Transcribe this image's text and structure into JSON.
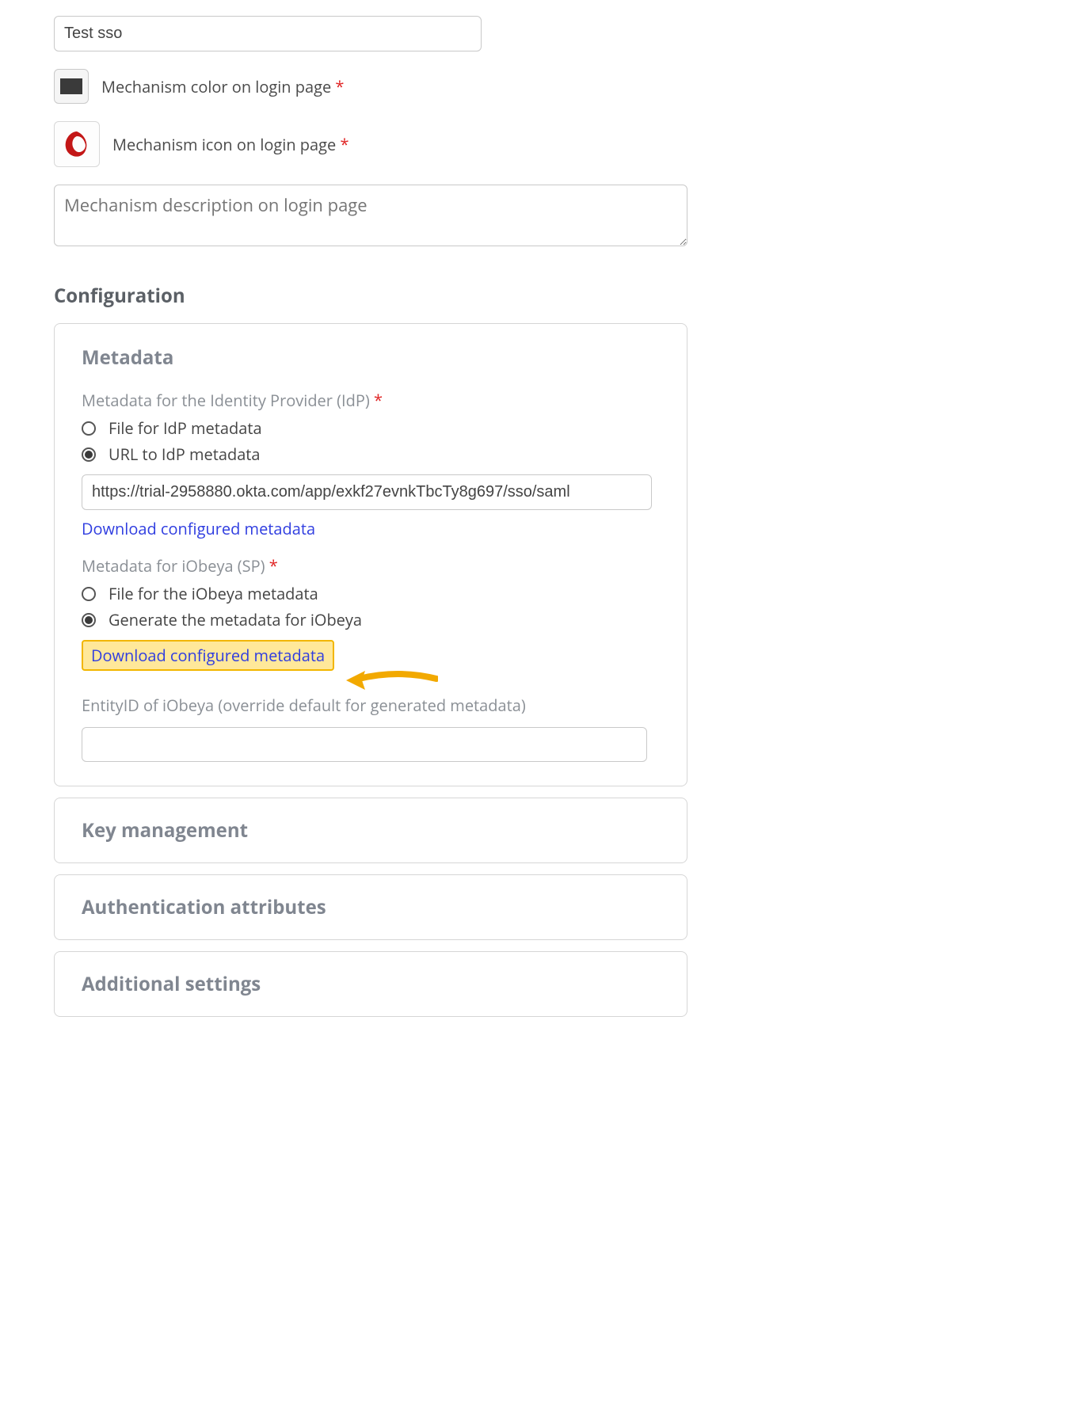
{
  "name_input": {
    "value": "Test sso"
  },
  "color": {
    "label": "Mechanism color on login page",
    "swatch": "#3a3a3a"
  },
  "icon": {
    "label": "Mechanism icon on login page"
  },
  "description": {
    "placeholder": "Mechanism description on login page"
  },
  "config_heading": "Configuration",
  "metadata": {
    "title": "Metadata",
    "idp": {
      "label": "Metadata for the Identity Provider (IdP)",
      "options": {
        "file": "File for IdP metadata",
        "url": "URL to IdP metadata"
      },
      "selected": "url",
      "url_value": "https://trial-2958880.okta.com/app/exkf27evnkTbcTy8g697/sso/saml",
      "download_link": "Download configured metadata"
    },
    "sp": {
      "label": "Metadata for iObeya (SP)",
      "options": {
        "file": "File for the iObeya metadata",
        "generate": "Generate the metadata for iObeya"
      },
      "selected": "generate",
      "download_link": "Download configured metadata",
      "entity_label": "EntityID of iObeya (override default for generated metadata)",
      "entity_value": ""
    }
  },
  "panels": {
    "key_mgmt": "Key management",
    "auth_attrs": "Authentication attributes",
    "additional": "Additional settings"
  }
}
